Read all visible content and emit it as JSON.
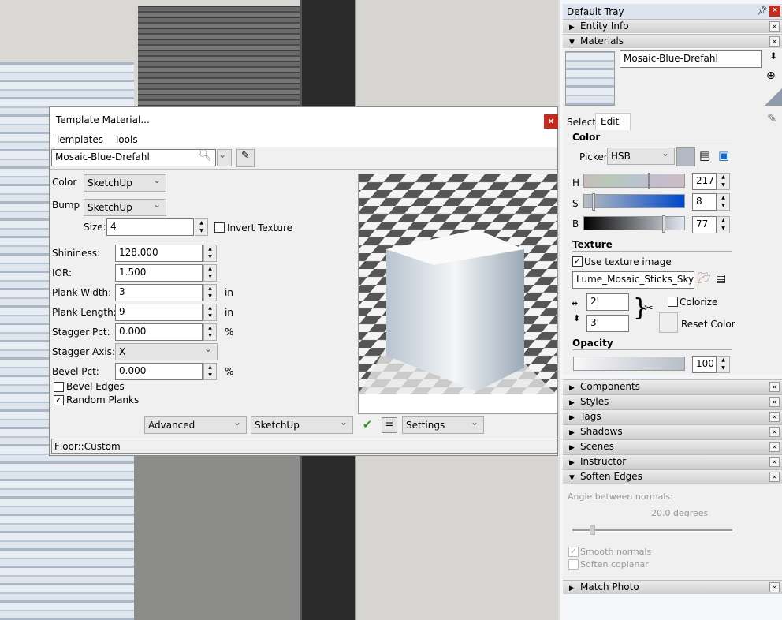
{
  "dialog": {
    "title": "Template Material...",
    "close": "×",
    "menu": [
      "Templates",
      "Tools"
    ],
    "material_name": "Mosaic-Blue-Drefahl",
    "color_label": "Color",
    "color_value": "SketchUp",
    "bump_label": "Bump",
    "bump_value": "SketchUp",
    "size_label": "Size:",
    "size_value": "4",
    "invert_texture": "Invert Texture",
    "invert_checked": false,
    "fields": [
      {
        "label": "Shininess:",
        "value": "128.000",
        "unit": ""
      },
      {
        "label": "IOR:",
        "value": "1.500",
        "unit": ""
      },
      {
        "label": "Plank Width:",
        "value": "3",
        "unit": "in"
      },
      {
        "label": "Plank Length:",
        "value": "9",
        "unit": "in"
      },
      {
        "label": "Stagger Pct:",
        "value": "0.000",
        "unit": "%"
      }
    ],
    "stagger_axis_label": "Stagger Axis:",
    "stagger_axis_value": "X",
    "bevel_label": "Bevel Pct:",
    "bevel_value": "0.000",
    "bevel_unit": "%",
    "bevel_edges": "Bevel Edges",
    "bevel_edges_checked": false,
    "random_planks": "Random Planks",
    "random_planks_checked": true,
    "mode": "Advanced",
    "renderer": "SketchUp",
    "settings": "Settings",
    "status": "Floor::Custom"
  },
  "tray": {
    "title": "Default Tray",
    "panels_top": [
      "Entity Info",
      "Materials"
    ],
    "materials": {
      "name": "Mosaic-Blue-Drefahl",
      "tabs": [
        "Select",
        "Edit"
      ],
      "color_heading": "Color",
      "picker_label": "Picker:",
      "picker_value": "HSB",
      "swatch_color": "#b4bac3",
      "h_label": "H",
      "h": "217",
      "s_label": "S",
      "s": "8",
      "b_label": "B",
      "b": "77",
      "texture_heading": "Texture",
      "use_texture": "Use texture image",
      "use_texture_checked": true,
      "texture_file": "Lume_Mosaic_Sticks_Sky Blue-",
      "width": "2'",
      "height": "3'",
      "colorize": "Colorize",
      "colorize_checked": false,
      "reset_color": "Reset Color",
      "opacity_heading": "Opacity",
      "opacity": "100"
    },
    "panels": [
      "Components",
      "Styles",
      "Tags",
      "Shadows",
      "Scenes",
      "Instructor"
    ],
    "soften": {
      "title": "Soften Edges",
      "angle_label": "Angle between normals:",
      "angle_value": "20.0  degrees",
      "slider_fraction": 0.11,
      "smooth_normals": "Smooth normals",
      "smooth_checked": true,
      "soften_coplanar": "Soften coplanar",
      "coplanar_checked": false
    },
    "match_photo": "Match Photo"
  }
}
